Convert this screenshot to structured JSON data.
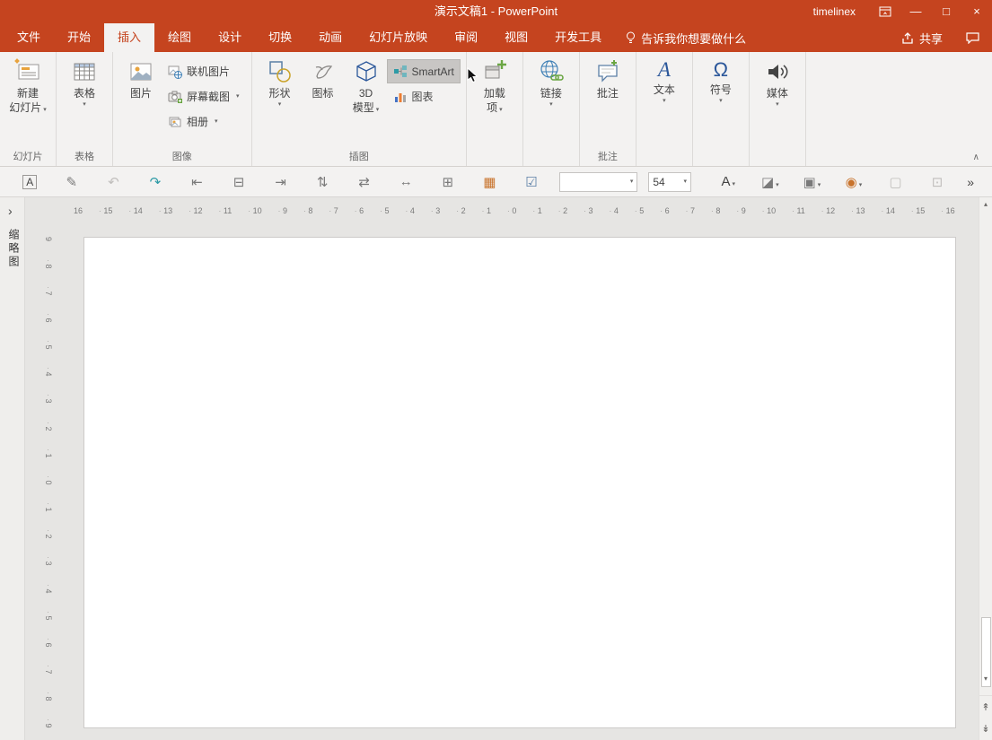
{
  "colors": {
    "titlebar_red": "#C5441F",
    "ribbon_bg": "#F3F2F1",
    "smartart_highlight": "#C8C6C4",
    "workspace_gray": "#E6E5E3",
    "accent_blue": "#2B579A"
  },
  "titlebar": {
    "title": "演示文稿1 - PowerPoint",
    "user": "timelinex",
    "minimize": "—",
    "maximize": "□",
    "close": "×"
  },
  "tabs": {
    "file": "文件",
    "home": "开始",
    "insert": "插入",
    "draw": "绘图",
    "design": "设计",
    "transitions": "切换",
    "animations": "动画",
    "slideshow": "幻灯片放映",
    "review": "审阅",
    "view": "视图",
    "developer": "开发工具",
    "tell_me": "告诉我你想要做什么",
    "share": "共享"
  },
  "ribbon": {
    "new_slide_line1": "新建",
    "new_slide_line2": "幻灯片",
    "table": "表格",
    "pictures": "图片",
    "online_pictures": "联机图片",
    "screenshot": "屏幕截图",
    "photo_album": "相册",
    "shapes": "形状",
    "icons_btn": "图标",
    "model3d_line1": "3D",
    "model3d_line2": "模型",
    "smartart": "SmartArt",
    "chart": "图表",
    "addins_line1": "加载",
    "addins_line2": "项",
    "links": "链接",
    "comment": "批注",
    "text": "文本",
    "symbol": "符号",
    "media": "媒体",
    "text_icon_glyph": "A",
    "symbol_icon_glyph": "Ω",
    "group_slides": "幻灯片",
    "group_tables": "表格",
    "group_images": "图像",
    "group_illustrations": "插图",
    "group_comments": "批注",
    "collapse": "∧"
  },
  "qat": {
    "icons": [
      "A",
      "✎",
      "↶",
      "↷",
      "⇤",
      "⊟",
      "⇥",
      "⇅",
      "⇄",
      "↔",
      "⊞",
      "▦",
      "☑"
    ],
    "font_name": "",
    "font_size": "54",
    "right_icons": [
      "A",
      "◪",
      "▣",
      "◉",
      "▢",
      "⊡"
    ],
    "more": "»"
  },
  "ui": {
    "caret": "▾",
    "scroll_up": "▴",
    "scroll_down": "▾",
    "prev_slide": "↟",
    "next_slide": "↡",
    "expand_pane": "›"
  },
  "left_pane": {
    "label": "缩略图"
  },
  "rulers": {
    "horizontal": [
      "16",
      "15",
      "14",
      "13",
      "12",
      "11",
      "10",
      "9",
      "8",
      "7",
      "6",
      "5",
      "4",
      "3",
      "2",
      "1",
      "0",
      "1",
      "2",
      "3",
      "4",
      "5",
      "6",
      "7",
      "8",
      "9",
      "10",
      "11",
      "12",
      "13",
      "14",
      "15",
      "16"
    ],
    "vertical": [
      "9",
      "8",
      "7",
      "6",
      "5",
      "4",
      "3",
      "2",
      "1",
      "0",
      "1",
      "2",
      "3",
      "4",
      "5",
      "6",
      "7",
      "8",
      "9"
    ]
  }
}
